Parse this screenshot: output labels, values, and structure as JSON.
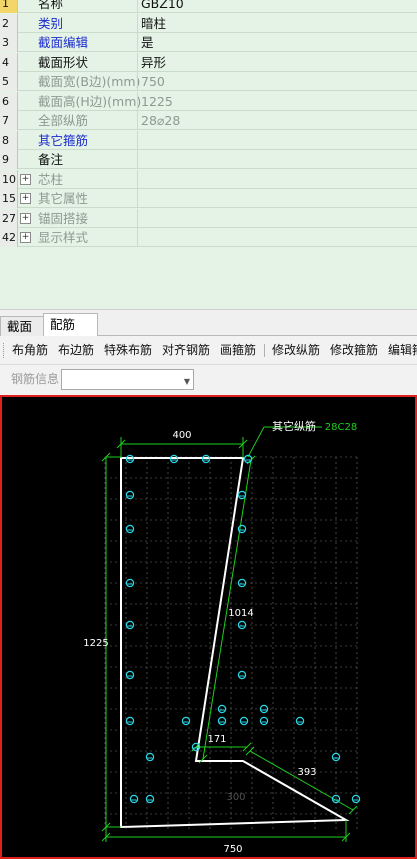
{
  "properties": [
    {
      "num": "1",
      "name": "名称",
      "value": "GBZ10",
      "name_style": "normal",
      "value_style": "normal",
      "expandable": false
    },
    {
      "num": "2",
      "name": "类别",
      "value": "暗柱",
      "name_style": "blue",
      "value_style": "normal",
      "expandable": false
    },
    {
      "num": "3",
      "name": "截面编辑",
      "value": "是",
      "name_style": "blue",
      "value_style": "normal",
      "expandable": false
    },
    {
      "num": "4",
      "name": "截面形状",
      "value": "异形",
      "name_style": "normal",
      "value_style": "normal",
      "expandable": false
    },
    {
      "num": "5",
      "name": "截面宽(B边)(mm)",
      "value": "750",
      "name_style": "gray",
      "value_style": "gray",
      "expandable": false
    },
    {
      "num": "6",
      "name": "截面高(H边)(mm)",
      "value": "1225",
      "name_style": "gray",
      "value_style": "gray",
      "expandable": false
    },
    {
      "num": "7",
      "name": "全部纵筋",
      "value": "28⌀28",
      "name_style": "gray",
      "value_style": "gray",
      "expandable": false
    },
    {
      "num": "8",
      "name": "其它箍筋",
      "value": "",
      "name_style": "blue",
      "value_style": "normal",
      "expandable": false
    },
    {
      "num": "9",
      "name": "备注",
      "value": "",
      "name_style": "normal",
      "value_style": "normal",
      "expandable": false
    },
    {
      "num": "10",
      "name": "芯柱",
      "value": "",
      "name_style": "gray",
      "value_style": "normal",
      "expandable": true
    },
    {
      "num": "15",
      "name": "其它属性",
      "value": "",
      "name_style": "gray",
      "value_style": "normal",
      "expandable": true
    },
    {
      "num": "27",
      "name": "锚固搭接",
      "value": "",
      "name_style": "gray",
      "value_style": "normal",
      "expandable": true
    },
    {
      "num": "42",
      "name": "显示样式",
      "value": "",
      "name_style": "gray",
      "value_style": "normal",
      "expandable": true
    }
  ],
  "tabs": {
    "section": "截面",
    "rebar": "配筋"
  },
  "toolbar": {
    "corner": "布角筋",
    "edge": "布边筋",
    "special": "特殊布筋",
    "align": "对齐钢筋",
    "stirrup": "画箍筋",
    "modify_long": "修改纵筋",
    "modify_stirrup": "修改箍筋",
    "edit": "编辑箍"
  },
  "rebar_info": {
    "label": "钢筋信息",
    "value": ""
  },
  "drawing": {
    "callout_text": "其它纵筋",
    "callout_value": "28C28",
    "dim_top": "400",
    "dim_left": "1225",
    "dim_bottom": "750",
    "dim_diagonal": "1014",
    "dim_small": "171",
    "dim_slope": "393",
    "dim_faint": "300",
    "colors": {
      "outline": "#ffffff",
      "dimension": "#1ecf1e",
      "grid": "#707070",
      "rebar": "#28d7e8",
      "callout_value": "#1ecf1e"
    }
  }
}
